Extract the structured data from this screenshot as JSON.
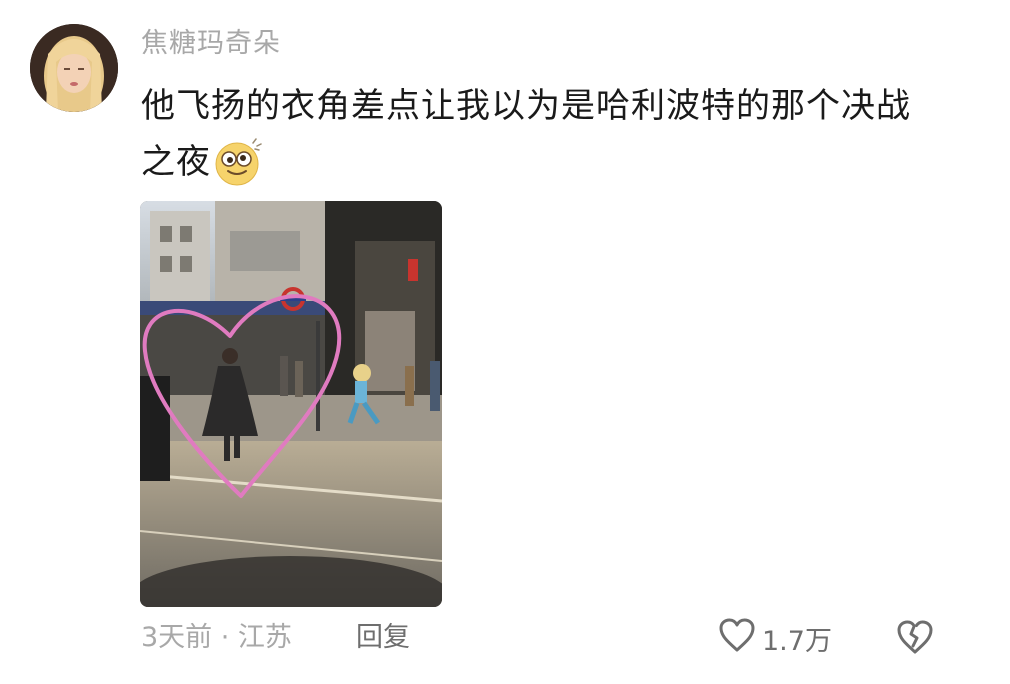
{
  "comment": {
    "username": "焦糖玛奇朵",
    "text_line1": "他飞扬的衣角差点让我以为是哈利波特的那个决战",
    "text_line2": "之夜",
    "emoji": "dizzy-face-emoji",
    "photo": {
      "description_icon": "street-photo",
      "overlay_color": "#e07bc0"
    },
    "meta": "3天前 · 江苏",
    "reply_label": "回复",
    "like_count": "1.7万",
    "like_icon": "heart-outline-icon",
    "dislike_icon": "broken-heart-icon"
  }
}
